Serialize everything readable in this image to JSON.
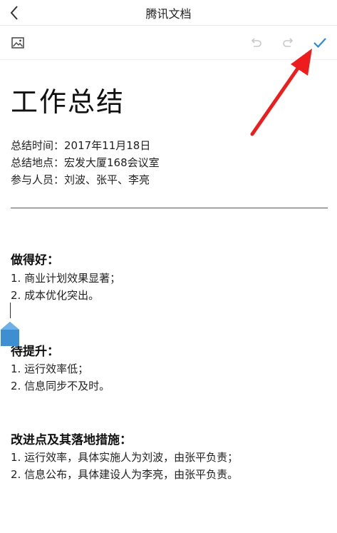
{
  "app": {
    "title": "腾讯文档"
  },
  "icons": {
    "back": "chevron-left-icon",
    "image": "image-icon",
    "undo": "undo-icon",
    "redo": "redo-icon",
    "done": "checkmark-icon"
  },
  "colors": {
    "accent": "#2b8ad6",
    "disabled": "#c8c8c8",
    "annotation": "#ee1c1c",
    "handle": "#3d8fd1"
  },
  "document": {
    "title": "工作总结",
    "meta": [
      "总结时间：2017年11月18日",
      "总结地点：宏发大厦168会议室",
      "参与人员：刘波、张平、李亮"
    ],
    "sections": [
      {
        "heading": "做得好：",
        "items": [
          "1. 商业计划效果显著；",
          "2. 成本优化突出。"
        ]
      },
      {
        "heading": "待提升：",
        "items": [
          "1. 运行效率低；",
          "2. 信息同步不及时。"
        ]
      },
      {
        "heading": "改进点及其落地措施：",
        "items": [
          "1. 运行效率，具体实施人为刘波，由张平负责；",
          "2. 信息公布，具体建设人为李亮，由张平负责。"
        ]
      }
    ]
  }
}
